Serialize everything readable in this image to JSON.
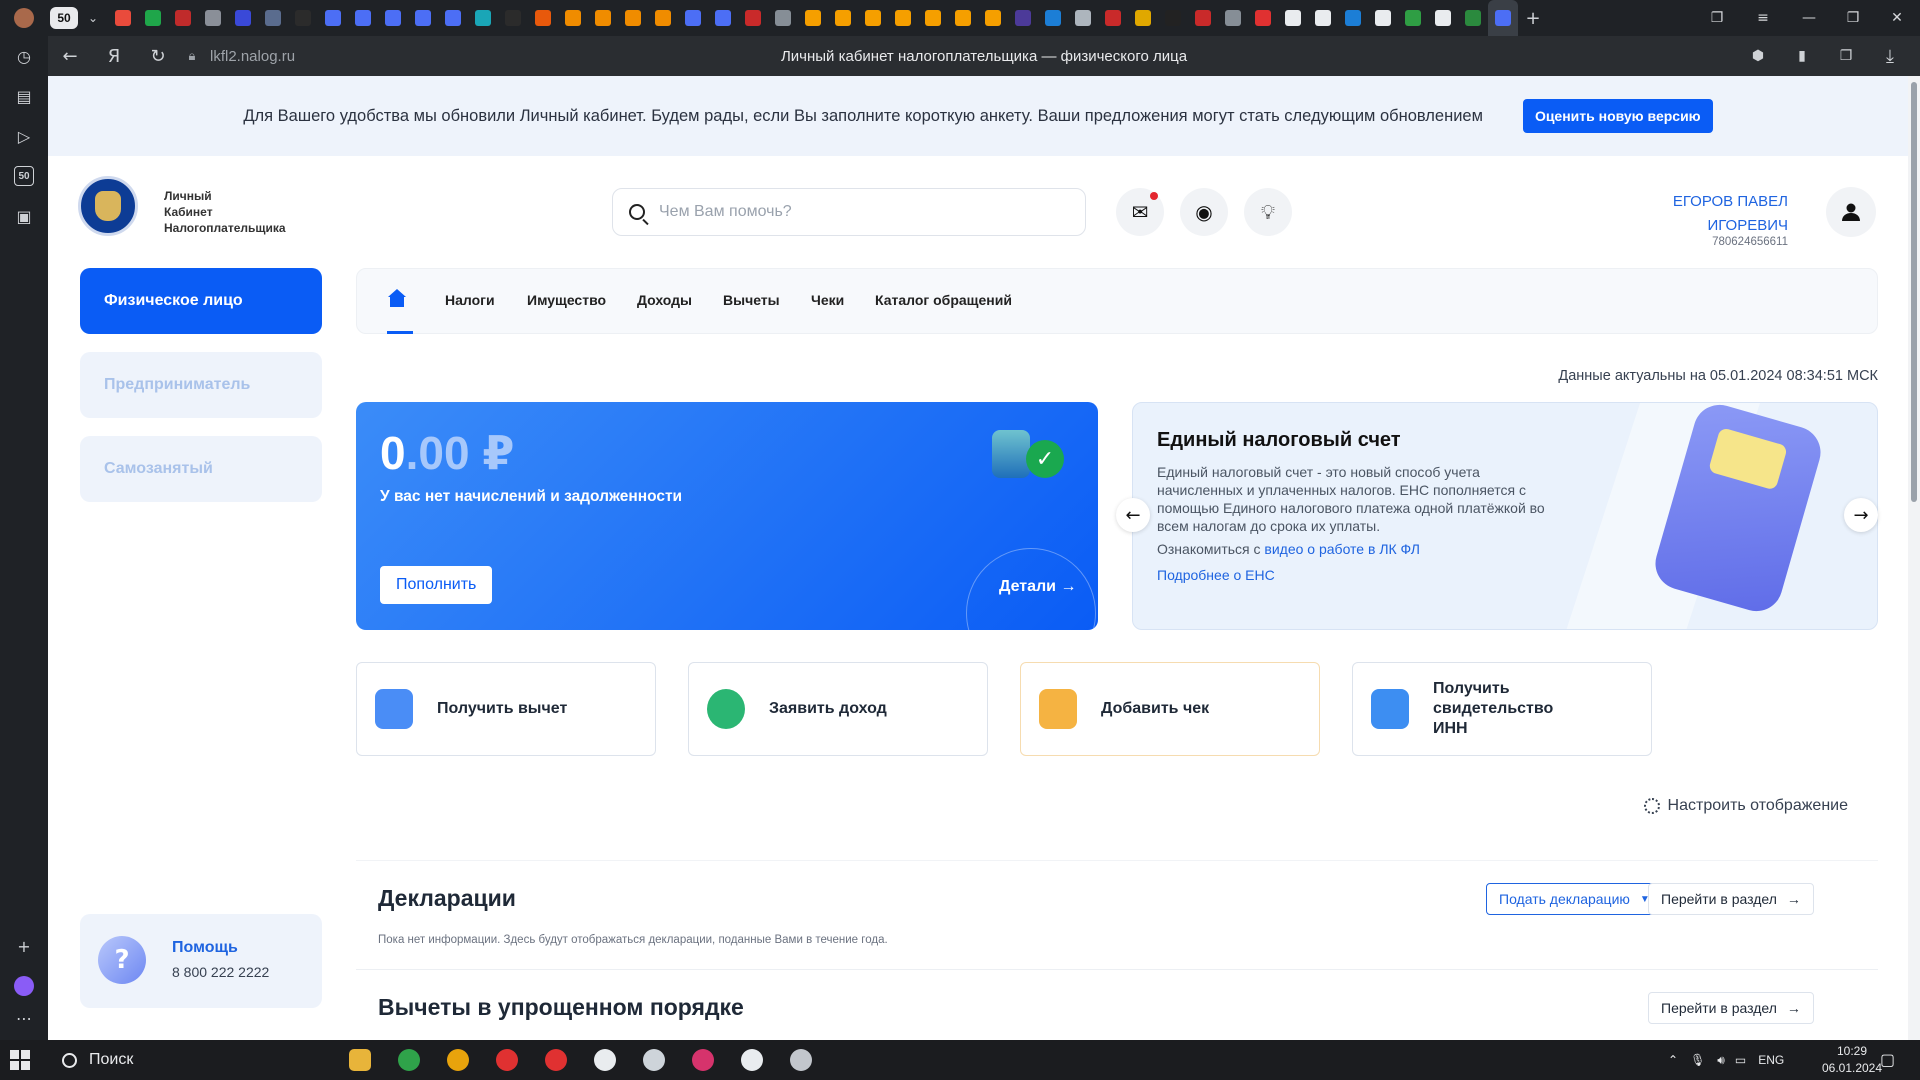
{
  "browser": {
    "tab_counter": "50",
    "address": "lkfl2.nalog.ru",
    "page_title": "Личный кабинет налогоплательщика — физического лица",
    "rail_counter": "50",
    "tab_colors": [
      "#e94b3c",
      "#1fa64a",
      "#c02b2b",
      "#8a8f98",
      "#3a49d8",
      "#5a6c8e",
      "#2b2b2b",
      "#4c6ef5",
      "#4c6ef5",
      "#4c6ef5",
      "#4c6ef5",
      "#4c6ef5",
      "#1aa6b7",
      "#2b2b2b",
      "#e8590c",
      "#f08c00",
      "#f08c00",
      "#f08c00",
      "#f08c00",
      "#4c6ef5",
      "#4c6ef5",
      "#c92a2a",
      "#868e96",
      "#f59f00",
      "#f59f00",
      "#f59f00",
      "#f59f00",
      "#f59f00",
      "#f59f00",
      "#f59f00",
      "#4c3a99",
      "#1c7ed6",
      "#adb5bd",
      "#c92a2a",
      "#e0a800",
      "#222222",
      "#c92a2a",
      "#868e96",
      "#e03131",
      "#e9ecef",
      "#e9ecef",
      "#1c7ed6",
      "#e9ecef",
      "#2f9e44",
      "#e9ecef",
      "#2b8a3e",
      "#4c6ef5"
    ]
  },
  "banner": {
    "text": "Для Вашего удобства мы обновили Личный кабинет. Будем рады, если Вы заполните короткую анкету. Ваши предложения могут стать следующим обновлением",
    "button": "Оценить новую версию"
  },
  "header": {
    "logo_text": [
      "Личный",
      "Кабинет",
      "Налогоплательщика"
    ],
    "search_placeholder": "Чем Вам помочь?",
    "user_name_line1": "ЕГОРОВ ПАВЕЛ",
    "user_name_line2": "ИГОРЕВИЧ",
    "user_inn": "780624656611"
  },
  "sidebar": {
    "items": [
      {
        "label": "Физическое лицо",
        "active": true
      },
      {
        "label": "Предприниматель",
        "active": false
      },
      {
        "label": "Самозанятый",
        "active": false
      }
    ],
    "help_title": "Помощь",
    "help_phone": "8 800 222 2222"
  },
  "nav": {
    "items": [
      "Налоги",
      "Имущество",
      "Доходы",
      "Вычеты",
      "Чеки",
      "Каталог обращений"
    ]
  },
  "data_actual": "Данные актуальны на 05.01.2024 08:34:51 МСК",
  "balance": {
    "amount_int": "0",
    "amount_frac": ".00 ₽",
    "status": "У вас нет начислений и задолженности",
    "topup_button": "Пополнить",
    "details_link": "Детали"
  },
  "ens": {
    "title": "Единый налоговый счет",
    "description": "Единый налоговый счет - это новый способ учета начисленных и уплаченных налогов. ЕНС пополняется с помощью Единого налогового платежа одной платёжкой во всем налогам до срока их уплаты.",
    "video_prefix": "Ознакомиться с",
    "video_link": "видео о работе в ЛК ФЛ",
    "more_link": "Подробнее о ЕНС"
  },
  "quick_actions": [
    {
      "label": "Получить вычет",
      "color": "#4a8df6"
    },
    {
      "label": "Заявить доход",
      "color": "#2bb673"
    },
    {
      "label": "Добавить чек",
      "color": "#f5b342"
    },
    {
      "label": "Получить свидетельство ИНН",
      "color": "#3d8ef2"
    }
  ],
  "configure": "Настроить отображение",
  "declarations": {
    "title": "Декларации",
    "note": "Пока нет информации. Здесь будут отображаться декларации, поданные Вами в течение года.",
    "submit_button": "Подать декларацию",
    "goto_button": "Перейти в раздел"
  },
  "deductions": {
    "title": "Вычеты в упрощенном порядке",
    "goto_button": "Перейти в раздел"
  },
  "taskbar": {
    "search": "Поиск",
    "lang": "ENG",
    "time": "10:29",
    "date": "06.01.2024",
    "app_colors": [
      "#e8b43a",
      "#2fa34a",
      "#e8a30c",
      "#e03131",
      "#e03131",
      "#e9ecef",
      "#ced4da",
      "#d6336c",
      "#e9ecef",
      "#c2c6cc"
    ]
  }
}
